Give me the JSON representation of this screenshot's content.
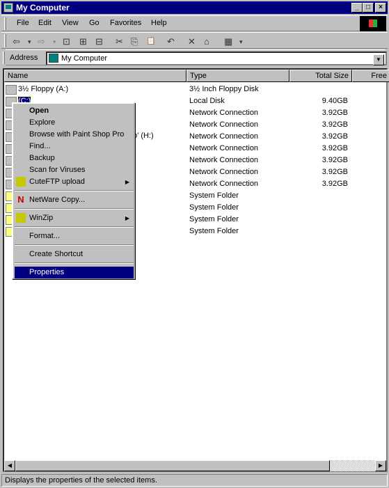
{
  "window": {
    "title": "My Computer",
    "min": "_",
    "max": "□",
    "close": "×"
  },
  "menubar": [
    "File",
    "Edit",
    "View",
    "Go",
    "Favorites",
    "Help"
  ],
  "toolbar": {
    "back": "⇦",
    "forward": "⇨",
    "up": "⊡",
    "map": "⊞",
    "disconnect": "⊟",
    "cut": "✂",
    "copy": "⎘",
    "paste": "📋",
    "undo": "↶",
    "delete": "✕",
    "properties": "⌂",
    "views": "▦",
    "dropdown": "▾"
  },
  "address": {
    "label": "Address",
    "value": "My Computer"
  },
  "columns": [
    "Name",
    "Type",
    "Total Size",
    "Free"
  ],
  "rows": [
    {
      "name": "3½ Floppy (A:)",
      "type": "3½ Inch Floppy Disk",
      "size": ""
    },
    {
      "name": "(C:)",
      "type": "Local Disk",
      "size": "9.40GB"
    },
    {
      "name": "",
      "type": "Network Connection",
      "size": "3.92GB"
    },
    {
      "name": "",
      "type": "Network Connection",
      "size": "3.92GB"
    },
    {
      "name": "po' (H:)",
      "type": "Network Connection",
      "size": "3.92GB"
    },
    {
      "name": "",
      "type": "Network Connection",
      "size": "3.92GB"
    },
    {
      "name": "",
      "type": "Network Connection",
      "size": "3.92GB"
    },
    {
      "name": "",
      "type": "Network Connection",
      "size": "3.92GB"
    },
    {
      "name": "",
      "type": "Network Connection",
      "size": "3.92GB"
    },
    {
      "name": "",
      "type": "System Folder",
      "size": ""
    },
    {
      "name": "",
      "type": "System Folder",
      "size": ""
    },
    {
      "name": "",
      "type": "System Folder",
      "size": ""
    },
    {
      "name": "",
      "type": "System Folder",
      "size": ""
    }
  ],
  "context_menu": [
    {
      "label": "Open",
      "bold": true
    },
    {
      "label": "Explore"
    },
    {
      "label": "Browse with Paint Shop Pro"
    },
    {
      "label": "Find..."
    },
    {
      "label": "Backup"
    },
    {
      "label": "Scan for Viruses"
    },
    {
      "label": "CuteFTP upload",
      "submenu": true,
      "icon": "cuteftp-icon"
    },
    {
      "label": "NetWare Copy...",
      "icon": "netware-icon",
      "icon_text": "N"
    },
    {
      "label": "WinZip",
      "submenu": true,
      "icon": "winzip-icon"
    },
    {
      "label": "Format..."
    },
    {
      "label": "Create Shortcut"
    },
    {
      "label": "Properties",
      "selected": true
    }
  ],
  "status": "Displays the properties of the selected items.",
  "colors": {
    "title": "#000080",
    "face": "#c0c0c0",
    "highlight": "#000080",
    "netware": "#cc0000"
  }
}
